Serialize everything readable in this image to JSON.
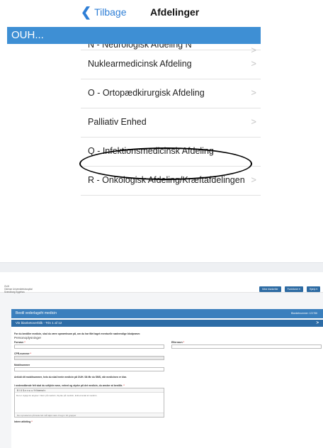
{
  "phone": {
    "back_label": "Tilbage",
    "back_icon": "chevron-left-icon",
    "title": "Afdelinger",
    "banner": "OUH...",
    "items": [
      {
        "label": "N - Neurologisk Afdeling N"
      },
      {
        "label": "Nuklearmedicinsk Afdeling"
      },
      {
        "label": "O - Ortopædkirurgisk Afdeling"
      },
      {
        "label": "Palliativ Enhed"
      },
      {
        "label": "Q - Infektionsmedicinsk Afdeling"
      },
      {
        "label": "R - Onkologisk Afdeling/Kræftafdelingen"
      }
    ],
    "row_arrow": ">",
    "accent": "#3e8fd4"
  },
  "web": {
    "logo_line1": "OUH",
    "logo_line2": "Odense Universitetshospital",
    "logo_line3": "Svendborg Sygehus",
    "header_buttons": [
      {
        "label": "Mine blanketter"
      },
      {
        "label": "Funktioner ▾"
      },
      {
        "label": "Hjælp ▾"
      }
    ],
    "panel_title": "Bestil vederlagsfri medicin",
    "panel_title_right": "Blanketnummer: 121766",
    "step_label": "Vis blanketoverblik - Trin 1 af 12",
    "step_arrow": ">",
    "intro": "For du bestiller medicin, skal du være opmærksom på, om du har fået taget eventuelle nødvendige blodprøver.",
    "section": "Personoplysninger",
    "firstname_label": "Fornavn",
    "lastname_label": "Efternavn",
    "cpr_label": "CPR-nummer",
    "mobile_label": "Mobilnummer",
    "mobile_hint": "Anfuld dit mobilnummer, hvis du skal hente medicin på OUH. Så får du SMS, når medicinen er klar.",
    "medicine_label": "I nedenstående felt skal du udfylde navn, enhed og styrke på det medicin, du ønsker at bestille.",
    "editor_toolbar": "B  I  U  S̶    ≡  ≡    ⊞  ⊟    %    Normal  ▾",
    "editor_placeholder": "Det er vigtigt du angiver: Navn på medicin, Styrke på medicin, Enhed antal af medicin.",
    "editor_footer": "Der oprustervrs på dette felt må højst være 0 tegn / 10 grupper",
    "next_label": "Intern afdeling",
    "required_mark": "*",
    "brand_color": "#2d6ba3"
  }
}
